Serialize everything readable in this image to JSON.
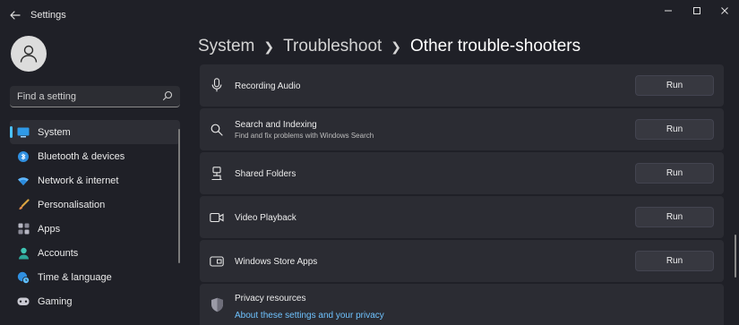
{
  "window": {
    "title": "Settings",
    "controls": [
      "minimize-icon",
      "maximize-icon",
      "close-icon"
    ]
  },
  "sidebar": {
    "search_placeholder": "Find a setting",
    "items": [
      {
        "label": "System",
        "icon": "monitor-icon",
        "active": true
      },
      {
        "label": "Bluetooth & devices",
        "icon": "bluetooth-icon"
      },
      {
        "label": "Network & internet",
        "icon": "wifi-icon"
      },
      {
        "label": "Personalisation",
        "icon": "brush-icon"
      },
      {
        "label": "Apps",
        "icon": "apps-icon"
      },
      {
        "label": "Accounts",
        "icon": "person-icon"
      },
      {
        "label": "Time & language",
        "icon": "globe-clock-icon"
      },
      {
        "label": "Gaming",
        "icon": "gamepad-icon"
      }
    ]
  },
  "breadcrumb": {
    "level1": "System",
    "level2": "Troubleshoot",
    "current": "Other trouble-shooters"
  },
  "troubleshooters": [
    {
      "title": "Recording Audio",
      "subtitle": "",
      "icon": "microphone-icon",
      "button": "Run"
    },
    {
      "title": "Search and Indexing",
      "subtitle": "Find and fix problems with Windows Search",
      "icon": "search-icon",
      "button": "Run"
    },
    {
      "title": "Shared Folders",
      "subtitle": "",
      "icon": "shared-folder-icon",
      "button": "Run"
    },
    {
      "title": "Video Playback",
      "subtitle": "",
      "icon": "video-camera-icon",
      "button": "Run"
    },
    {
      "title": "Windows Store Apps",
      "subtitle": "",
      "icon": "window-app-icon",
      "button": "Run"
    }
  ],
  "privacy": {
    "title": "Privacy resources",
    "link": "About these settings and your privacy",
    "icon": "shield-icon"
  },
  "colors": {
    "accent": "#4cc2ff",
    "link": "#6fc3ff",
    "card": "#2b2c33",
    "background": "#1f2027"
  }
}
